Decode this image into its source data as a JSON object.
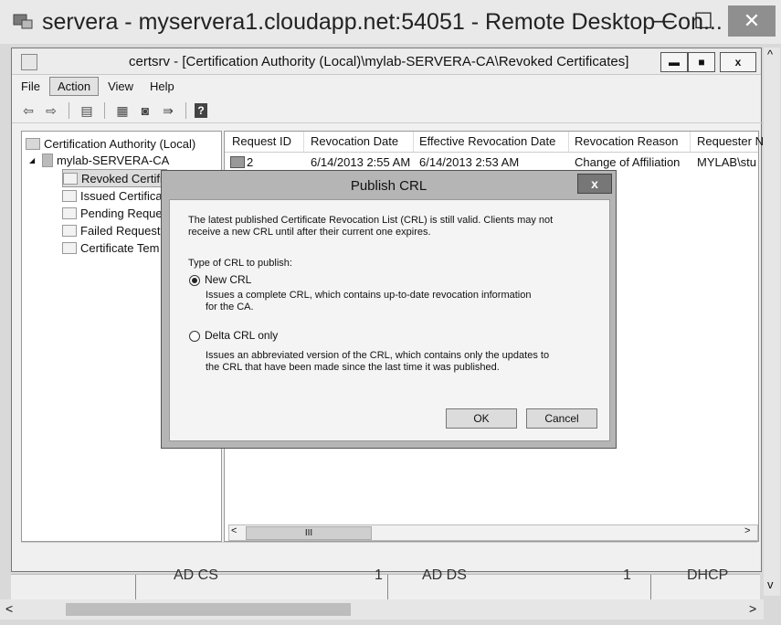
{
  "rdp": {
    "title": "servera - myservera1.cloudapp.net:54051 - Remote Desktop Con...",
    "min_label": "—",
    "max_label": "☐",
    "close_label": "✕"
  },
  "mmc": {
    "title": "certsrv - [Certification Authority (Local)\\mylab-SERVERA-CA\\Revoked Certificates]",
    "min_label": "▬",
    "max_label": "■",
    "close_label": "x"
  },
  "menu": [
    "File",
    "Action",
    "View",
    "Help"
  ],
  "toolbar": {
    "back_label": "⇦",
    "forward_label": "⇨",
    "up_label": "▤",
    "show_label": "▦",
    "refresh_label": "◙",
    "export_label": "⇛",
    "help_label": "?"
  },
  "tree": {
    "root": "Certification Authority (Local)",
    "ca": "mylab-SERVERA-CA",
    "expand_glyph": "◢",
    "items": [
      "Revoked Certifi",
      "Issued Certifica",
      "Pending Reque",
      "Failed Requests",
      "Certificate Tem"
    ]
  },
  "list": {
    "columns": [
      "Request ID",
      "Revocation Date",
      "Effective Revocation Date",
      "Revocation Reason",
      "Requester N"
    ],
    "rows": [
      [
        "2",
        "6/14/2013 2:55 AM",
        "6/14/2013 2:53 AM",
        "Change of Affiliation",
        "MYLAB\\stu"
      ]
    ],
    "scroll_left": "<",
    "scroll_right": ">",
    "scroll_thumb": "III"
  },
  "dialog": {
    "title": "Publish CRL",
    "close_label": "x",
    "intro_line1": "The latest published Certificate Revocation List (CRL) is still valid. Clients may not",
    "intro_line2": "receive a new CRL until after their current one expires.",
    "type_label": "Type of CRL to publish:",
    "option_new_label": "New CRL",
    "option_new_desc1": "Issues a complete CRL, which contains up-to-date revocation information",
    "option_new_desc2": "for the CA.",
    "option_delta_label": "Delta CRL only",
    "option_delta_desc1": "Issues an abbreviated version of the CRL, which contains only the updates to",
    "option_delta_desc2": "the CRL that have been made since the last time it was published.",
    "selected_option": "New CRL",
    "ok_label": "OK",
    "cancel_label": "Cancel"
  },
  "dashboard": {
    "tiles": [
      "AD CS",
      "1",
      "AD DS",
      "1",
      "DHCP"
    ]
  },
  "outer_scroll": {
    "up": "^",
    "down": "v",
    "left": "<",
    "right": ">"
  }
}
